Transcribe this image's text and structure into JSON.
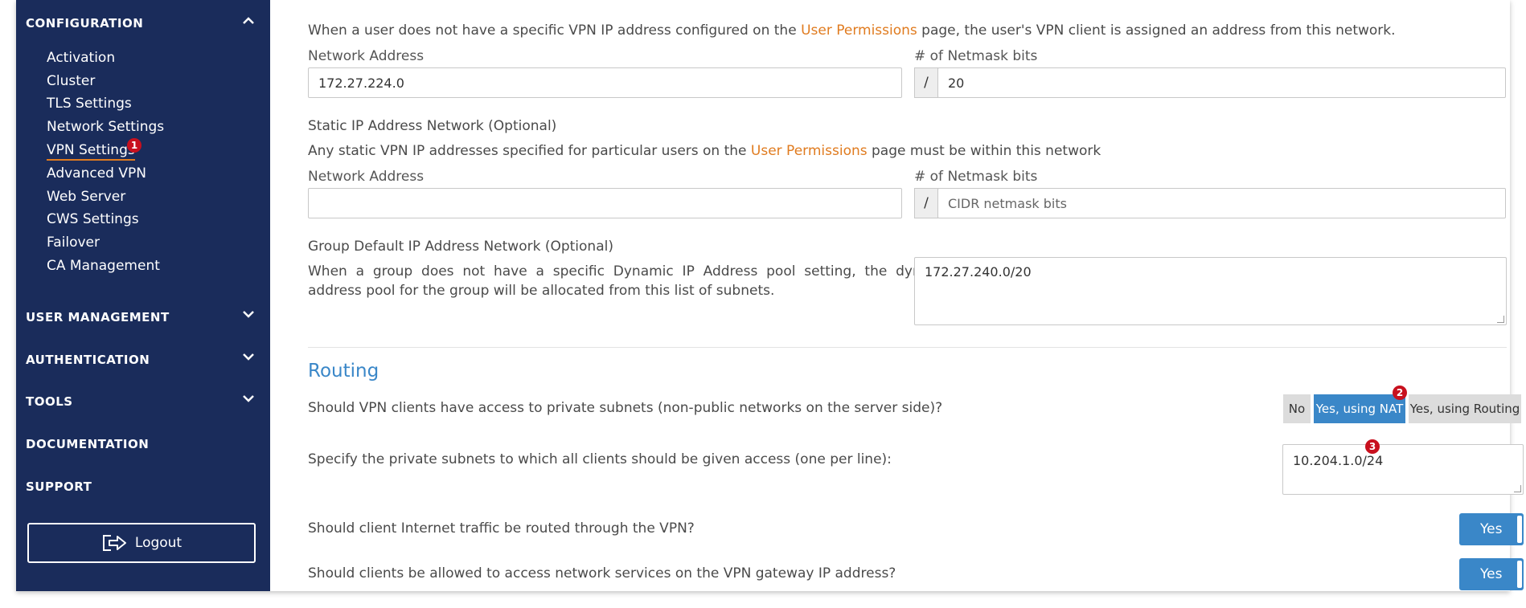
{
  "sidebar": {
    "configuration_header": "CONFIGURATION",
    "config_items": [
      {
        "label": "Activation"
      },
      {
        "label": "Cluster"
      },
      {
        "label": "TLS Settings"
      },
      {
        "label": "Network Settings"
      },
      {
        "label": "VPN Settings",
        "badge": "1"
      },
      {
        "label": "Advanced VPN"
      },
      {
        "label": "Web Server"
      },
      {
        "label": "CWS Settings"
      },
      {
        "label": "Failover"
      },
      {
        "label": "CA Management"
      }
    ],
    "sections": [
      {
        "label": "USER  MANAGEMENT"
      },
      {
        "label": "AUTHENTICATION"
      },
      {
        "label": "TOOLS"
      },
      {
        "label": "DOCUMENTATION"
      },
      {
        "label": "SUPPORT"
      }
    ],
    "logout_label": "Logout"
  },
  "dynamic_network": {
    "desc_part1": "When a user does not have a specific VPN IP address configured on the ",
    "desc_link": "User Permissions",
    "desc_part2": " page, the user's VPN client is assigned an address from this network.",
    "network_address_label": "Network Address",
    "network_address_value": "172.27.224.0",
    "netmask_label": "# of Netmask bits",
    "slash": "/",
    "netmask_value": "20"
  },
  "static_network": {
    "title": "Static IP Address Network (Optional)",
    "desc_part1": "Any static VPN IP addresses specified for particular users on the ",
    "desc_link": "User Permissions",
    "desc_part2": " page must be within this network",
    "network_address_label": "Network Address",
    "network_address_value": "",
    "netmask_label": "# of Netmask bits",
    "slash": "/",
    "netmask_placeholder": "CIDR netmask bits"
  },
  "group_network": {
    "title": "Group Default IP Address Network (Optional)",
    "desc_line1": "When  a  group  does  not  have  a  specific  Dynamic  IP  Address  pool  setting,  the  dynamic  IP",
    "desc_line2": "address pool for the group will be allocated from this list of subnets.",
    "value": "172.27.240.0/20"
  },
  "routing": {
    "heading": "Routing",
    "q1": "Should VPN clients have access to private subnets (non-public networks on the server side)?",
    "q1_options": [
      "No",
      "Yes, using NAT",
      "Yes, using Routing"
    ],
    "q1_selected": "Yes, using NAT",
    "q1_badge": "2",
    "q2": "Specify the private subnets to which all clients should be given access (one per line):",
    "q2_value": "10.204.1.0/24",
    "q2_badge": "3",
    "q3": "Should client Internet traffic be routed through the VPN?",
    "q3_value": "Yes",
    "q4": "Should clients be allowed to access network services on the VPN gateway IP address?",
    "q4_value": "Yes"
  },
  "colors": {
    "sidebar_bg": "#1a2c5b",
    "accent_blue": "#3a87c8",
    "link_orange": "#e07b1f",
    "badge_red": "#c8101e"
  }
}
